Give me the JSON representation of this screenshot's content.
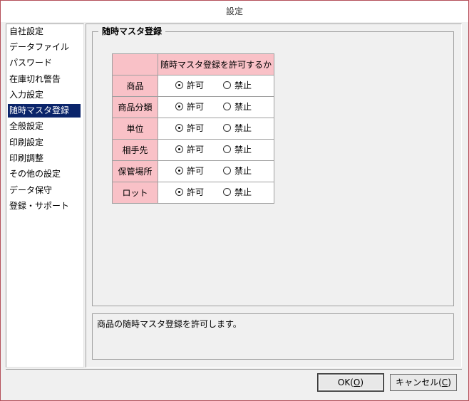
{
  "window": {
    "title": "設定"
  },
  "sidebar": {
    "items": [
      {
        "label": "自社設定",
        "selected": false
      },
      {
        "label": "データファイル",
        "selected": false
      },
      {
        "label": "パスワード",
        "selected": false
      },
      {
        "label": "在庫切れ警告",
        "selected": false
      },
      {
        "label": "入力設定",
        "selected": false
      },
      {
        "label": "随時マスタ登録",
        "selected": true
      },
      {
        "label": "全般設定",
        "selected": false
      },
      {
        "label": "印刷設定",
        "selected": false
      },
      {
        "label": "印刷調整",
        "selected": false
      },
      {
        "label": "その他の設定",
        "selected": false
      },
      {
        "label": "データ保守",
        "selected": false
      },
      {
        "label": "登録・サポート",
        "selected": false
      }
    ]
  },
  "group": {
    "title": "随時マスタ登録",
    "column_header": "随時マスタ登録を許可するか",
    "allow_label": "許可",
    "deny_label": "禁止",
    "rows": [
      {
        "label": "商品",
        "value": "許可"
      },
      {
        "label": "商品分類",
        "value": "許可"
      },
      {
        "label": "単位",
        "value": "許可"
      },
      {
        "label": "相手先",
        "value": "許可"
      },
      {
        "label": "保管場所",
        "value": "許可"
      },
      {
        "label": "ロット",
        "value": "許可"
      }
    ]
  },
  "description": "商品の随時マスタ登録を許可します。",
  "buttons": {
    "ok_label": "OK(",
    "ok_key": "O",
    "cancel_label": "キャンセル(",
    "cancel_key": "C",
    "close_paren": ")"
  },
  "colors": {
    "header_bg": "#f9c1c7",
    "selection_bg": "#0a246a",
    "window_border": "#b4505a"
  }
}
